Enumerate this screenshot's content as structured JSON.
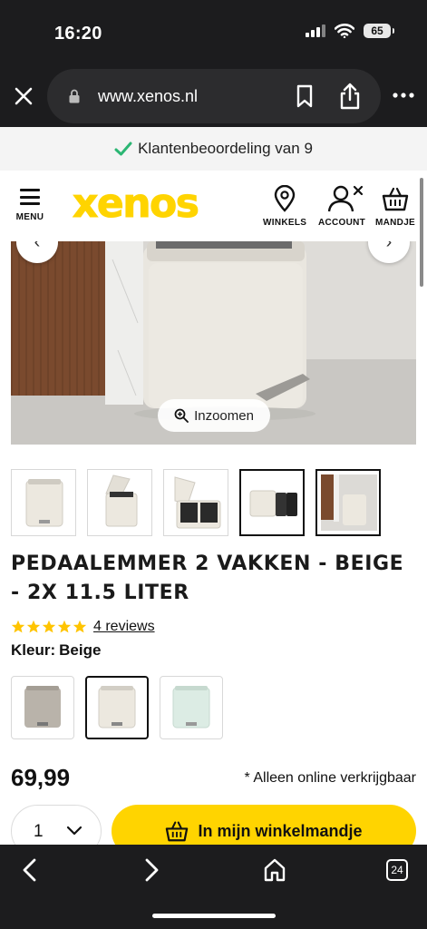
{
  "status_bar": {
    "time": "16:20",
    "battery": "65"
  },
  "browser": {
    "url": "www.xenos.nl",
    "tab_count": "24"
  },
  "banner": {
    "text": "Klantenbeoordeling van 9"
  },
  "header": {
    "menu_label": "MENU",
    "logo": "xenos",
    "stores_label": "WINKELS",
    "account_label": "ACCOUNT",
    "cart_label": "MANDJE"
  },
  "product": {
    "zoom_label": "Inzoomen",
    "title": "PEDAALEMMER 2 VAKKEN - BEIGE - 2X 11.5 LITER",
    "rating": 5,
    "reviews_link": "4 reviews",
    "colour_label": "Kleur:",
    "colour_value": "Beige",
    "price": "69,99",
    "availability_note": "* Alleen online verkrijgbaar",
    "quantity": "1",
    "add_to_cart_label": "In mijn winkelmandje",
    "thumbnails": [
      "front-view",
      "open-lid",
      "inner-buckets",
      "side-by-side",
      "bathroom-scene"
    ],
    "active_thumbnail": 3,
    "swatches": [
      "Taupe",
      "Beige",
      "Mint"
    ],
    "active_swatch": 1
  },
  "colors": {
    "brand_yellow": "#ffd400",
    "star": "#ffc400",
    "check_green": "#2bb673"
  }
}
